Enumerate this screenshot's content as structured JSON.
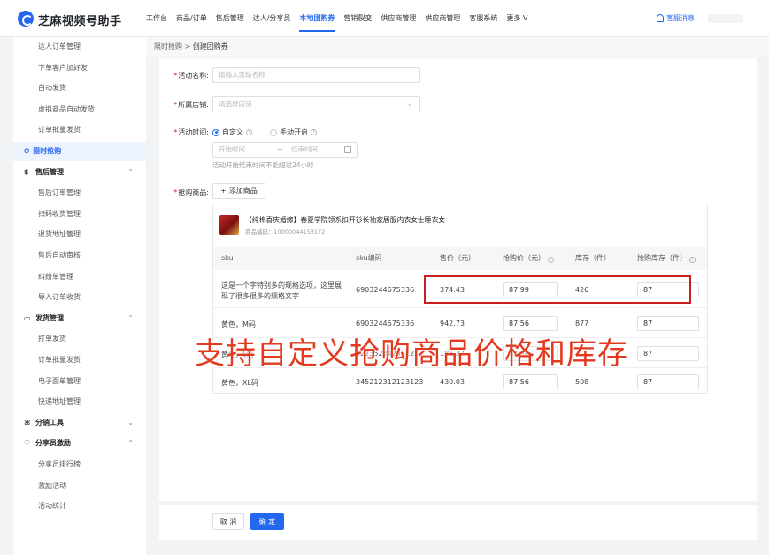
{
  "app": {
    "name": "芝麻视频号助手"
  },
  "nav": {
    "items": [
      "工作台",
      "商品/订单",
      "售后管理",
      "达人/分享员",
      "本地团购券",
      "营销裂变",
      "供应商管理",
      "供应商管理",
      "客服系统",
      "更多 V"
    ],
    "active_index": 4,
    "kefu_label": "客服消息"
  },
  "sidebar": {
    "entries": [
      {
        "type": "item",
        "label": "达人订单管理"
      },
      {
        "type": "item",
        "label": "下单客户加好友"
      },
      {
        "type": "item",
        "label": "自动发货"
      },
      {
        "type": "item",
        "label": "虚拟商品自动发货"
      },
      {
        "type": "item",
        "label": "订单批量发货"
      },
      {
        "type": "active",
        "label": "限时抢购"
      },
      {
        "type": "group",
        "label": "售后管理",
        "chevron": "^"
      },
      {
        "type": "item",
        "label": "售后订单管理"
      },
      {
        "type": "item",
        "label": "扫码收货管理"
      },
      {
        "type": "item",
        "label": "退货地址管理"
      },
      {
        "type": "item",
        "label": "售后自动审核"
      },
      {
        "type": "item",
        "label": "纠纷单管理"
      },
      {
        "type": "item",
        "label": "导入订单收货"
      },
      {
        "type": "group",
        "label": "发货管理",
        "chevron": "^"
      },
      {
        "type": "item",
        "label": "打单发货"
      },
      {
        "type": "item",
        "label": "订单批量发货"
      },
      {
        "type": "item",
        "label": "电子面单管理"
      },
      {
        "type": "item",
        "label": "快递地址管理"
      },
      {
        "type": "group",
        "label": "分销工具",
        "chevron": "v"
      },
      {
        "type": "group",
        "label": "分享员激励",
        "chevron": "^"
      },
      {
        "type": "item",
        "label": "分享员排行榜"
      },
      {
        "type": "item",
        "label": "激励活动"
      },
      {
        "type": "item",
        "label": "活动统计"
      }
    ]
  },
  "breadcrumb": {
    "parent": "限时抢购",
    "sep": ">",
    "current": "创建团购券"
  },
  "form": {
    "name_label": "活动名称:",
    "name_placeholder": "请输入活动名称",
    "shop_label": "所属店铺:",
    "shop_placeholder": "请选择店铺",
    "time_label": "活动时间:",
    "radio_custom": "自定义",
    "radio_manual": "手动开启",
    "start_placeholder": "开始时间",
    "end_placeholder": "结束时间",
    "arrow": "→",
    "time_hint": "活动开始结束时间不能超过24小时",
    "goods_label": "抢购商品:",
    "add_goods": "添加商品"
  },
  "product": {
    "name": "【纯棉喜庆婚嫁】春夏学院领系扣开衫长袖家居服内衣女士睡衣女",
    "code": "商品编码：10000044153172",
    "headers": [
      "sku",
      "sku编码",
      "售价（元）",
      "抢购价（元）",
      "库存（件）",
      "抢购库存（件）"
    ],
    "rows": [
      {
        "sku": "这是一个字特别多的规格选项，这里展现了很多很多的规格文字",
        "code": "6903244675336",
        "price": "374.43",
        "flash_price": "87.99",
        "stock": "426",
        "flash_stock": "87"
      },
      {
        "sku": "黄色，M码",
        "code": "6903244675336",
        "price": "942.73",
        "flash_price": "87.56",
        "stock": "877",
        "flash_stock": "87"
      },
      {
        "sku": "黄色，L码",
        "code": "1223523423312",
        "price": "186.37",
        "flash_price": "87.56",
        "stock": "",
        "flash_stock": "87"
      },
      {
        "sku": "黄色，XL码",
        "code": "345212312123123",
        "price": "430.03",
        "flash_price": "87.56",
        "stock": "508",
        "flash_stock": "87"
      }
    ]
  },
  "overlay_caption": "支持自定义抢购商品价格和库存",
  "footer": {
    "cancel": "取 消",
    "confirm": "确 定"
  },
  "colors": {
    "accent": "#2468f2",
    "highlight": "#c61f1f",
    "caption": "#e23a1f"
  }
}
